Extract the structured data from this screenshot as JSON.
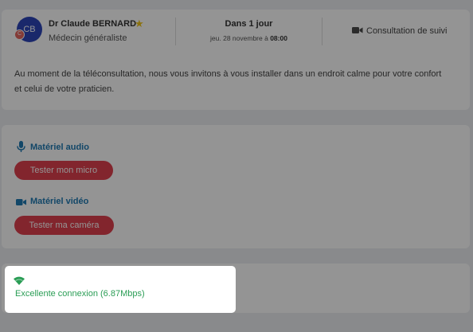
{
  "appointment": {
    "avatar_initials": "CB",
    "avatar_badge": "C",
    "doctor_name": "Dr Claude BERNARD",
    "specialty": "Médecin généraliste",
    "when": "Dans 1 jour",
    "date_prefix": "jeu. 28 novembre à ",
    "time": "08:00",
    "consultation_type": "Consultation de suivi",
    "info_text": "Au moment de la téléconsultation, nous vous invitons à vous installer dans un endroit calme pour votre confort et celui de votre praticien."
  },
  "equipment": {
    "audio_title": "Matériel audio",
    "audio_button": "Tester mon micro",
    "video_title": "Matériel vidéo",
    "video_button": "Tester ma caméra"
  },
  "connection": {
    "status_text": "Excellente connexion (6.87Mbps)"
  },
  "colors": {
    "accent_blue": "#207ab4",
    "button_red": "#e0404e",
    "status_green": "#2a9d55",
    "star_yellow": "#f0c419",
    "avatar_blue": "#2d46b9"
  },
  "icons": {
    "favorite": "star-icon",
    "consultation": "video-camera-icon",
    "audio": "microphone-icon",
    "video": "video-camera-icon",
    "connection": "wifi-icon"
  }
}
